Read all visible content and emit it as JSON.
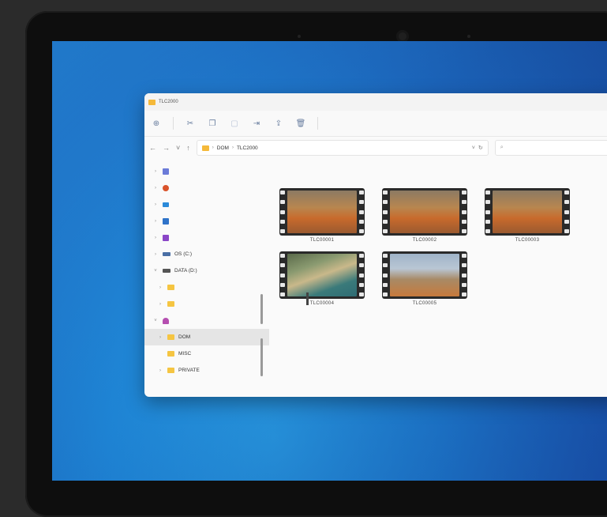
{
  "window": {
    "title": "TLC2000"
  },
  "toolbar": {
    "icons": [
      "new-icon",
      "cut-icon",
      "copy-icon",
      "paste-icon",
      "rename-icon",
      "share-icon",
      "delete-icon"
    ]
  },
  "address": {
    "crumbs": [
      "DOM",
      "TLC2000"
    ],
    "search_placeholder": ""
  },
  "sidebar": {
    "items": [
      {
        "label": "",
        "icon": "gallery-icon",
        "color": "#6b7bd8"
      },
      {
        "label": "",
        "icon": "app-icon",
        "color": "#d9532b"
      },
      {
        "label": "",
        "icon": "desktop-icon",
        "color": "#2b8ad9"
      },
      {
        "label": "",
        "icon": "pictures-icon",
        "color": "#2f73c9"
      },
      {
        "label": "",
        "icon": "videos-icon",
        "color": "#8a46c7"
      },
      {
        "label": "OS (C:)",
        "icon": "drive-icon"
      },
      {
        "label": "DATA (D:)",
        "icon": "drive-icon"
      },
      {
        "label": "",
        "icon": "folder-icon"
      },
      {
        "label": "",
        "icon": "folder-icon"
      },
      {
        "label": "",
        "icon": "user-icon",
        "color": "#b54fb0"
      },
      {
        "label": "DOM",
        "icon": "folder-icon"
      },
      {
        "label": "MISC",
        "icon": "folder-icon"
      },
      {
        "label": "PRIVATE",
        "icon": "folder-icon"
      }
    ]
  },
  "files": [
    {
      "name": "TLC00001"
    },
    {
      "name": "TLC00002"
    },
    {
      "name": "TLC00003"
    },
    {
      "name": "TLC00004"
    },
    {
      "name": "TLC00005"
    }
  ]
}
